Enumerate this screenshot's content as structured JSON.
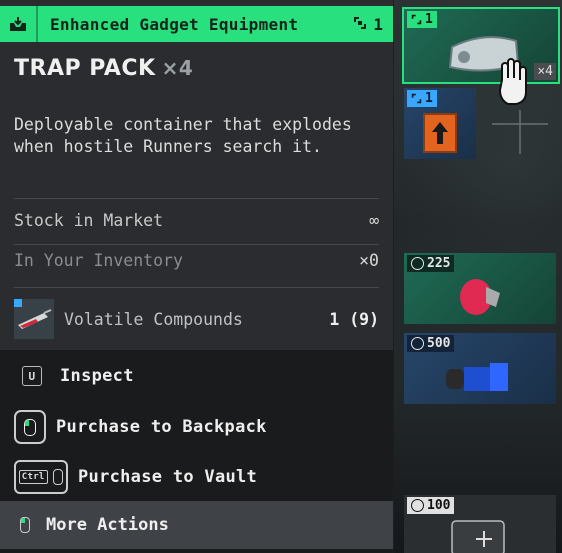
{
  "header": {
    "category": "Enhanced Gadget Equipment",
    "slot_count": "1"
  },
  "item": {
    "name": "TRAP PACK",
    "multiplier": "×4",
    "description": "Deployable container that explodes when hostile Runners search it."
  },
  "stats": [
    {
      "label": "Stock in Market",
      "value": "∞"
    },
    {
      "label": "In Your Inventory",
      "value": "×0"
    }
  ],
  "component": {
    "label": "Volatile Compounds",
    "quantity": "1 (9)"
  },
  "actions": {
    "inspect": "Inspect",
    "inspect_key": "U",
    "purchase_backpack": "Purchase to Backpack",
    "purchase_vault": "Purchase to Vault",
    "ctrl_key": "Ctrl",
    "more": "More Actions"
  },
  "tiles": [
    {
      "badge": "1",
      "stack": "×4",
      "color": "green"
    },
    {
      "badge": "1",
      "color": "blue"
    },
    {
      "price": "225"
    },
    {
      "price": "500"
    },
    {
      "price": "100"
    }
  ],
  "colors": {
    "accent": "#29e07f",
    "rare": "#3aa7ff",
    "panel": "#2a2c2f"
  }
}
